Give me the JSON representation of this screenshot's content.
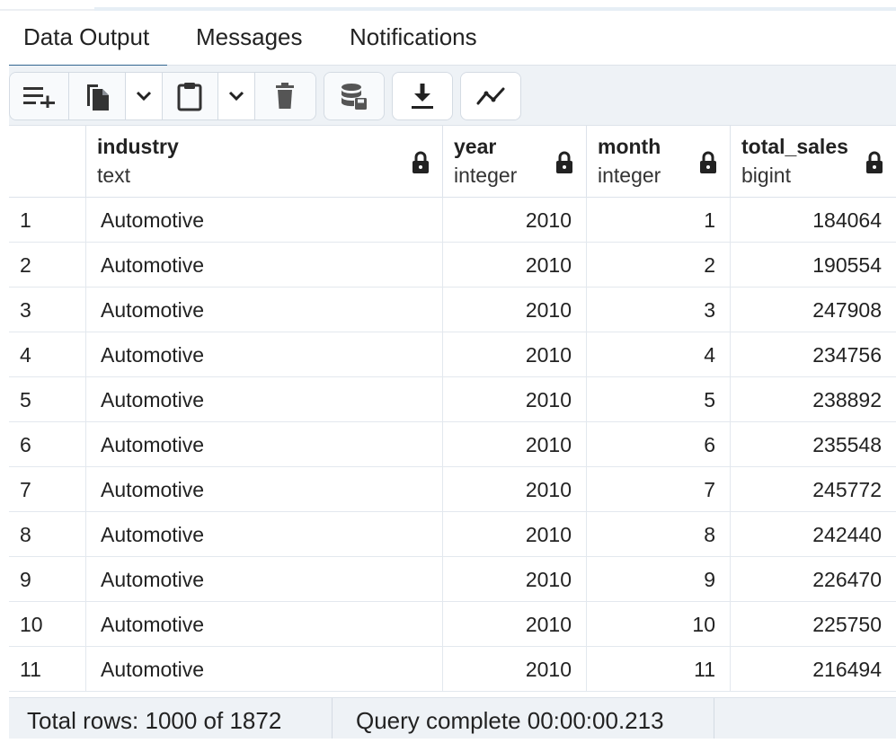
{
  "tabs": [
    {
      "label": "Data Output",
      "active": true
    },
    {
      "label": "Messages",
      "active": false
    },
    {
      "label": "Notifications",
      "active": false
    }
  ],
  "toolbar": {
    "icons": [
      "add-row-icon",
      "copy-icon",
      "chevron-down-icon",
      "paste-icon",
      "chevron-down-icon",
      "delete-icon",
      "save-data-icon",
      "download-icon",
      "graph-visualiser-icon"
    ]
  },
  "grid": {
    "columns": [
      {
        "name": "industry",
        "type": "text"
      },
      {
        "name": "year",
        "type": "integer"
      },
      {
        "name": "month",
        "type": "integer"
      },
      {
        "name": "total_sales",
        "type": "bigint"
      }
    ],
    "rows": [
      {
        "n": "1",
        "industry": "Automotive",
        "year": "2010",
        "month": "1",
        "total_sales": "184064"
      },
      {
        "n": "2",
        "industry": "Automotive",
        "year": "2010",
        "month": "2",
        "total_sales": "190554"
      },
      {
        "n": "3",
        "industry": "Automotive",
        "year": "2010",
        "month": "3",
        "total_sales": "247908"
      },
      {
        "n": "4",
        "industry": "Automotive",
        "year": "2010",
        "month": "4",
        "total_sales": "234756"
      },
      {
        "n": "5",
        "industry": "Automotive",
        "year": "2010",
        "month": "5",
        "total_sales": "238892"
      },
      {
        "n": "6",
        "industry": "Automotive",
        "year": "2010",
        "month": "6",
        "total_sales": "235548"
      },
      {
        "n": "7",
        "industry": "Automotive",
        "year": "2010",
        "month": "7",
        "total_sales": "245772"
      },
      {
        "n": "8",
        "industry": "Automotive",
        "year": "2010",
        "month": "8",
        "total_sales": "242440"
      },
      {
        "n": "9",
        "industry": "Automotive",
        "year": "2010",
        "month": "9",
        "total_sales": "226470"
      },
      {
        "n": "10",
        "industry": "Automotive",
        "year": "2010",
        "month": "10",
        "total_sales": "225750"
      },
      {
        "n": "11",
        "industry": "Automotive",
        "year": "2010",
        "month": "11",
        "total_sales": "216494"
      }
    ]
  },
  "status": {
    "total_rows": "Total rows: 1000 of 1872",
    "query": "Query complete 00:00:00.213"
  },
  "colors": {
    "accent": "#326690",
    "toolbar_bg": "#eef2f6",
    "grid_line": "#dde3ea"
  }
}
